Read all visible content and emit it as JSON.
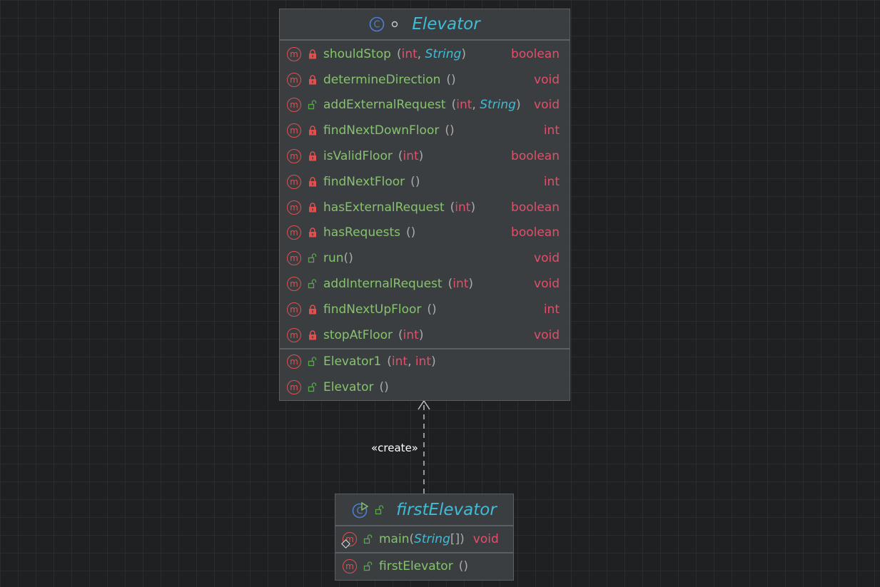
{
  "elevator": {
    "stereotype_icon": "class-icon",
    "name": "Elevator",
    "methods": [
      {
        "name": "shouldStop",
        "params": [
          {
            "t": "int",
            "ref": false
          },
          {
            "t": "String",
            "ref": true
          }
        ],
        "returns": "boolean",
        "visibility": "private"
      },
      {
        "name": "determineDirection",
        "params": [],
        "returns": "void",
        "visibility": "private"
      },
      {
        "name": "addExternalRequest",
        "params": [
          {
            "t": "int",
            "ref": false
          },
          {
            "t": "String",
            "ref": true
          }
        ],
        "returns": "void",
        "visibility": "public"
      },
      {
        "name": "findNextDownFloor",
        "params": [],
        "returns": "int",
        "visibility": "private"
      },
      {
        "name": "isValidFloor",
        "params": [
          {
            "t": "int",
            "ref": false
          }
        ],
        "returns": "boolean",
        "visibility": "private"
      },
      {
        "name": "findNextFloor",
        "params": [],
        "returns": "int",
        "visibility": "private"
      },
      {
        "name": "hasExternalRequest",
        "params": [
          {
            "t": "int",
            "ref": false
          }
        ],
        "returns": "boolean",
        "visibility": "private"
      },
      {
        "name": "hasRequests",
        "params": [],
        "returns": "boolean",
        "visibility": "private"
      },
      {
        "name": "run",
        "params": [],
        "returns": "void",
        "visibility": "public",
        "tight": true
      },
      {
        "name": "addInternalRequest",
        "params": [
          {
            "t": "int",
            "ref": false
          }
        ],
        "returns": "void",
        "visibility": "public"
      },
      {
        "name": "findNextUpFloor",
        "params": [],
        "returns": "int",
        "visibility": "private"
      },
      {
        "name": "stopAtFloor",
        "params": [
          {
            "t": "int",
            "ref": false
          }
        ],
        "returns": "void",
        "visibility": "private"
      }
    ],
    "constructors": [
      {
        "name": "Elevator1",
        "params": [
          {
            "t": "int",
            "ref": false
          },
          {
            "t": "int",
            "ref": false
          }
        ],
        "returns": "",
        "visibility": "public"
      },
      {
        "name": "Elevator",
        "params": [],
        "returns": "",
        "visibility": "public"
      }
    ]
  },
  "relation": {
    "label": "«create»"
  },
  "first_elevator": {
    "name": "firstElevator",
    "methods": [
      {
        "name": "main",
        "params": [
          {
            "t": "String",
            "ref": true,
            "array": true
          }
        ],
        "returns": "void",
        "visibility": "public",
        "tight": true,
        "static": true
      }
    ],
    "constructors": [
      {
        "name": "firstElevator",
        "params": [],
        "returns": "",
        "visibility": "public"
      }
    ]
  },
  "colors": {
    "background": "#1f2022",
    "class_box": "#3b3e41",
    "class_name": "#3fbdd6",
    "method_name": "#86c36d",
    "type_keyword": "#e0506a",
    "method_badge": "#e0504f",
    "class_badge": "#4b7fd6"
  }
}
